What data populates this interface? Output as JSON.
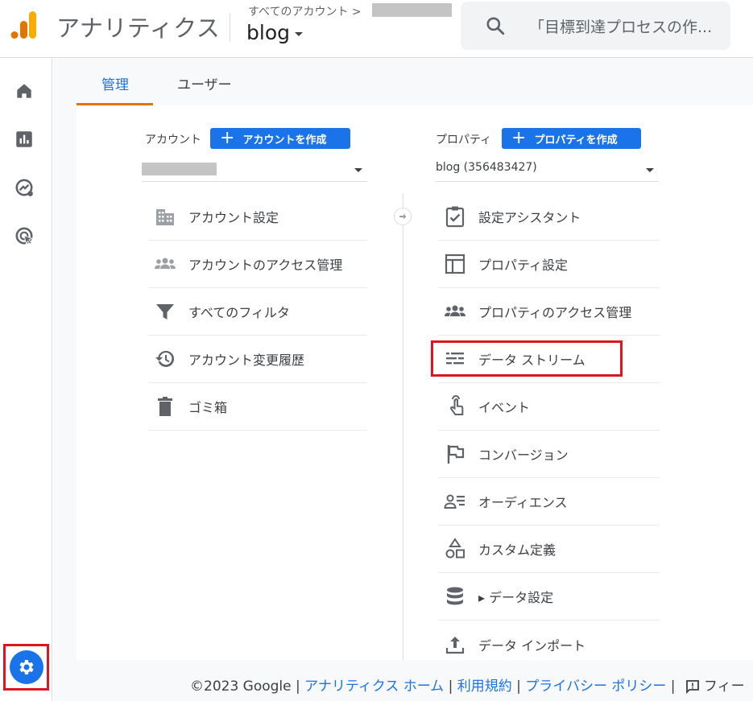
{
  "header": {
    "app_name": "アナリティクス",
    "breadcrumb": "すべてのアカウント >",
    "property_name": "blog",
    "search_placeholder": "「目標到達プロセスの作..."
  },
  "tabs": [
    {
      "label": "管理",
      "active": true
    },
    {
      "label": "ユーザー",
      "active": false
    }
  ],
  "account": {
    "label": "アカウント",
    "create_label": "アカウントを作成",
    "selected": "",
    "items": [
      {
        "label": "アカウント設定",
        "icon": "building-icon"
      },
      {
        "label": "アカウントのアクセス管理",
        "icon": "people-icon"
      },
      {
        "label": "すべてのフィルタ",
        "icon": "filter-icon"
      },
      {
        "label": "アカウント変更履歴",
        "icon": "history-icon"
      },
      {
        "label": "ゴミ箱",
        "icon": "trash-icon"
      }
    ]
  },
  "property": {
    "label": "プロパティ",
    "create_label": "プロパティを作成",
    "selected": "blog (356483427)",
    "items": [
      {
        "label": "設定アシスタント",
        "icon": "clipboard-check-icon"
      },
      {
        "label": "プロパティ設定",
        "icon": "layout-icon"
      },
      {
        "label": "プロパティのアクセス管理",
        "icon": "people-icon"
      },
      {
        "label": "データ ストリーム",
        "icon": "streams-icon"
      },
      {
        "label": "イベント",
        "icon": "touch-icon"
      },
      {
        "label": "コンバージョン",
        "icon": "flag-icon"
      },
      {
        "label": "オーディエンス",
        "icon": "audience-icon"
      },
      {
        "label": "カスタム定義",
        "icon": "shapes-icon"
      },
      {
        "label": "▸ データ設定",
        "icon": "database-icon"
      },
      {
        "label": "データ インポート",
        "icon": "upload-icon"
      }
    ]
  },
  "footer": {
    "copyright": "©2023 Google |",
    "link_home": "アナリティクス ホーム",
    "sep1": "|",
    "link_terms": "利用規約",
    "sep2": "|",
    "link_privacy": "プライバシー ポリシー",
    "sep3": "|",
    "feedback": "フィー"
  },
  "colors": {
    "accent": "#1a73e8",
    "tab_underline": "#e37400",
    "highlight": "#e0141e"
  }
}
